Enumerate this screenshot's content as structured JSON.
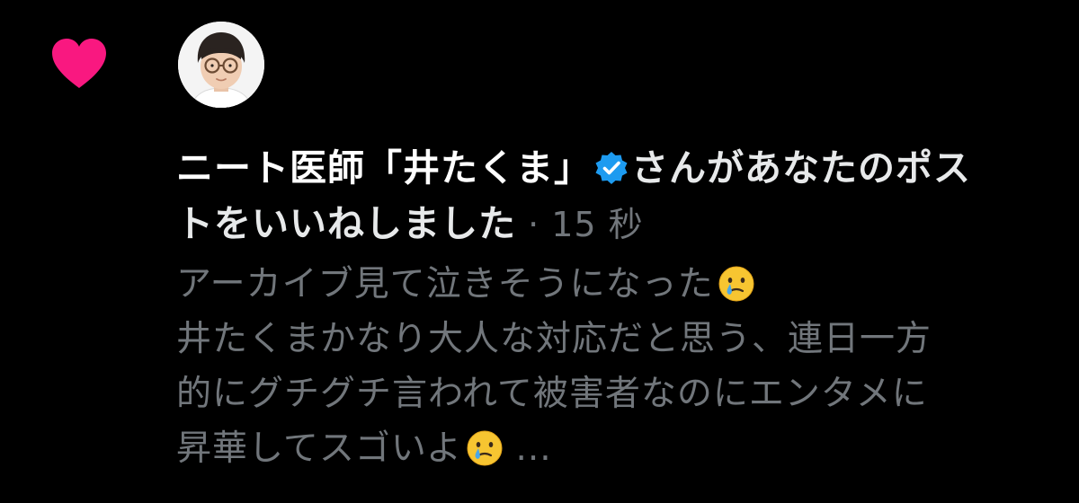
{
  "notification": {
    "type_icon": "heart-icon",
    "heart_color": "#f91880",
    "avatar_alt": "user-avatar",
    "user_name": "ニート医師「井たくま」",
    "verified_icon": "verified-badge-icon",
    "verified_color": "#1d9bf0",
    "action_text_1": "さんがあなたのポス",
    "action_text_2": "トをいいねしました",
    "separator": " · ",
    "time_ago": "15 秒",
    "post_lines": [
      "アーカイブ見て泣きそうになった",
      "井たくまかなり大人な対応だと思う、連日一方",
      "的にグチグチ言われて被害者なのにエンタメに",
      "昇華してスゴいよ"
    ],
    "emoji_name": "face-holding-back-tears-emoji",
    "ellipsis": " ..."
  }
}
